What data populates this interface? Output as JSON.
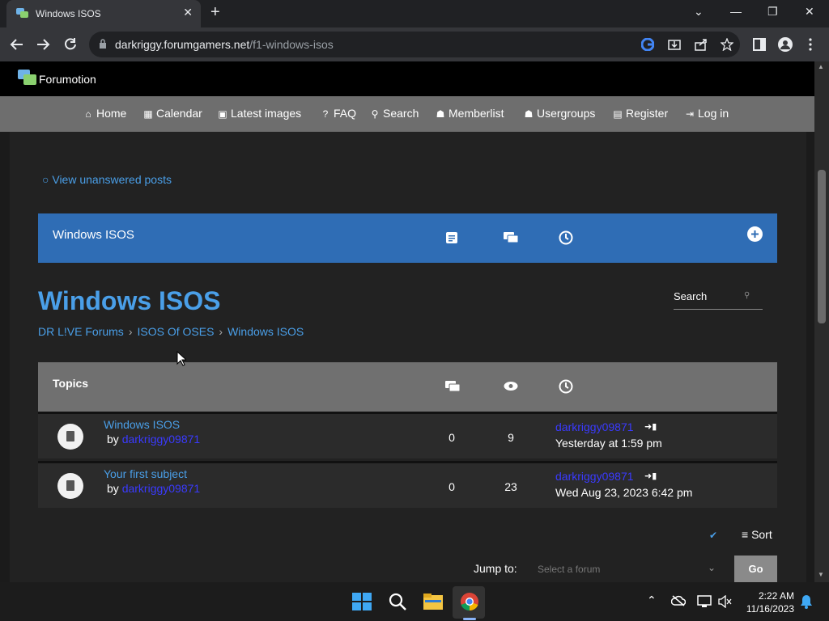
{
  "browser": {
    "tab_title": "Windows ISOS",
    "tab_close": "✕",
    "new_tab": "+",
    "url_domain": "darkriggy.forumgamers.net",
    "url_path": "/f1-windows-isos",
    "window_buttons": [
      "⌄",
      "—",
      "❐",
      "✕"
    ]
  },
  "forumotion": {
    "label": "Forumotion"
  },
  "nav": {
    "items": [
      {
        "label": "Home",
        "icon": "⌂"
      },
      {
        "label": "Calendar",
        "icon": "▦"
      },
      {
        "label": "Latest images",
        "icon": "▣"
      },
      {
        "label": "FAQ",
        "icon": "?"
      },
      {
        "label": "Search",
        "icon": "⚲"
      },
      {
        "label": "Memberlist",
        "icon": "☗"
      },
      {
        "label": "Usergroups",
        "icon": "☗"
      },
      {
        "label": "Register",
        "icon": "▤"
      },
      {
        "label": "Log in",
        "icon": "⇥"
      }
    ]
  },
  "main": {
    "unanswered": "View unanswered posts",
    "forum_header_title": "Windows ISOS",
    "page_title": "Windows ISOS",
    "search_label": "Search",
    "breadcrumb": [
      "DR L!VE Forums",
      "ISOS Of OSES",
      "Windows ISOS"
    ],
    "topics_label": "Topics",
    "topics": [
      {
        "title": "Windows ISOS",
        "by": "by",
        "author": "darkriggy09871",
        "replies": "0",
        "views": "9",
        "last_user": "darkriggy09871",
        "last_date": "Yesterday at 1:59 pm"
      },
      {
        "title": "Your first subject",
        "by": "by",
        "author": "darkriggy09871",
        "replies": "0",
        "views": "23",
        "last_user": "darkriggy09871",
        "last_date": "Wed Aug 23, 2023 6:42 pm"
      }
    ],
    "sort_label": "Sort",
    "jump_label": "Jump to:",
    "jump_placeholder": "Select a forum",
    "go_label": "Go"
  },
  "taskbar": {
    "time": "2:22 AM",
    "date": "11/16/2023"
  },
  "colors": {
    "accent": "#4a9fe8",
    "header_blue": "#2f6db5",
    "author": "#3a3aff"
  }
}
